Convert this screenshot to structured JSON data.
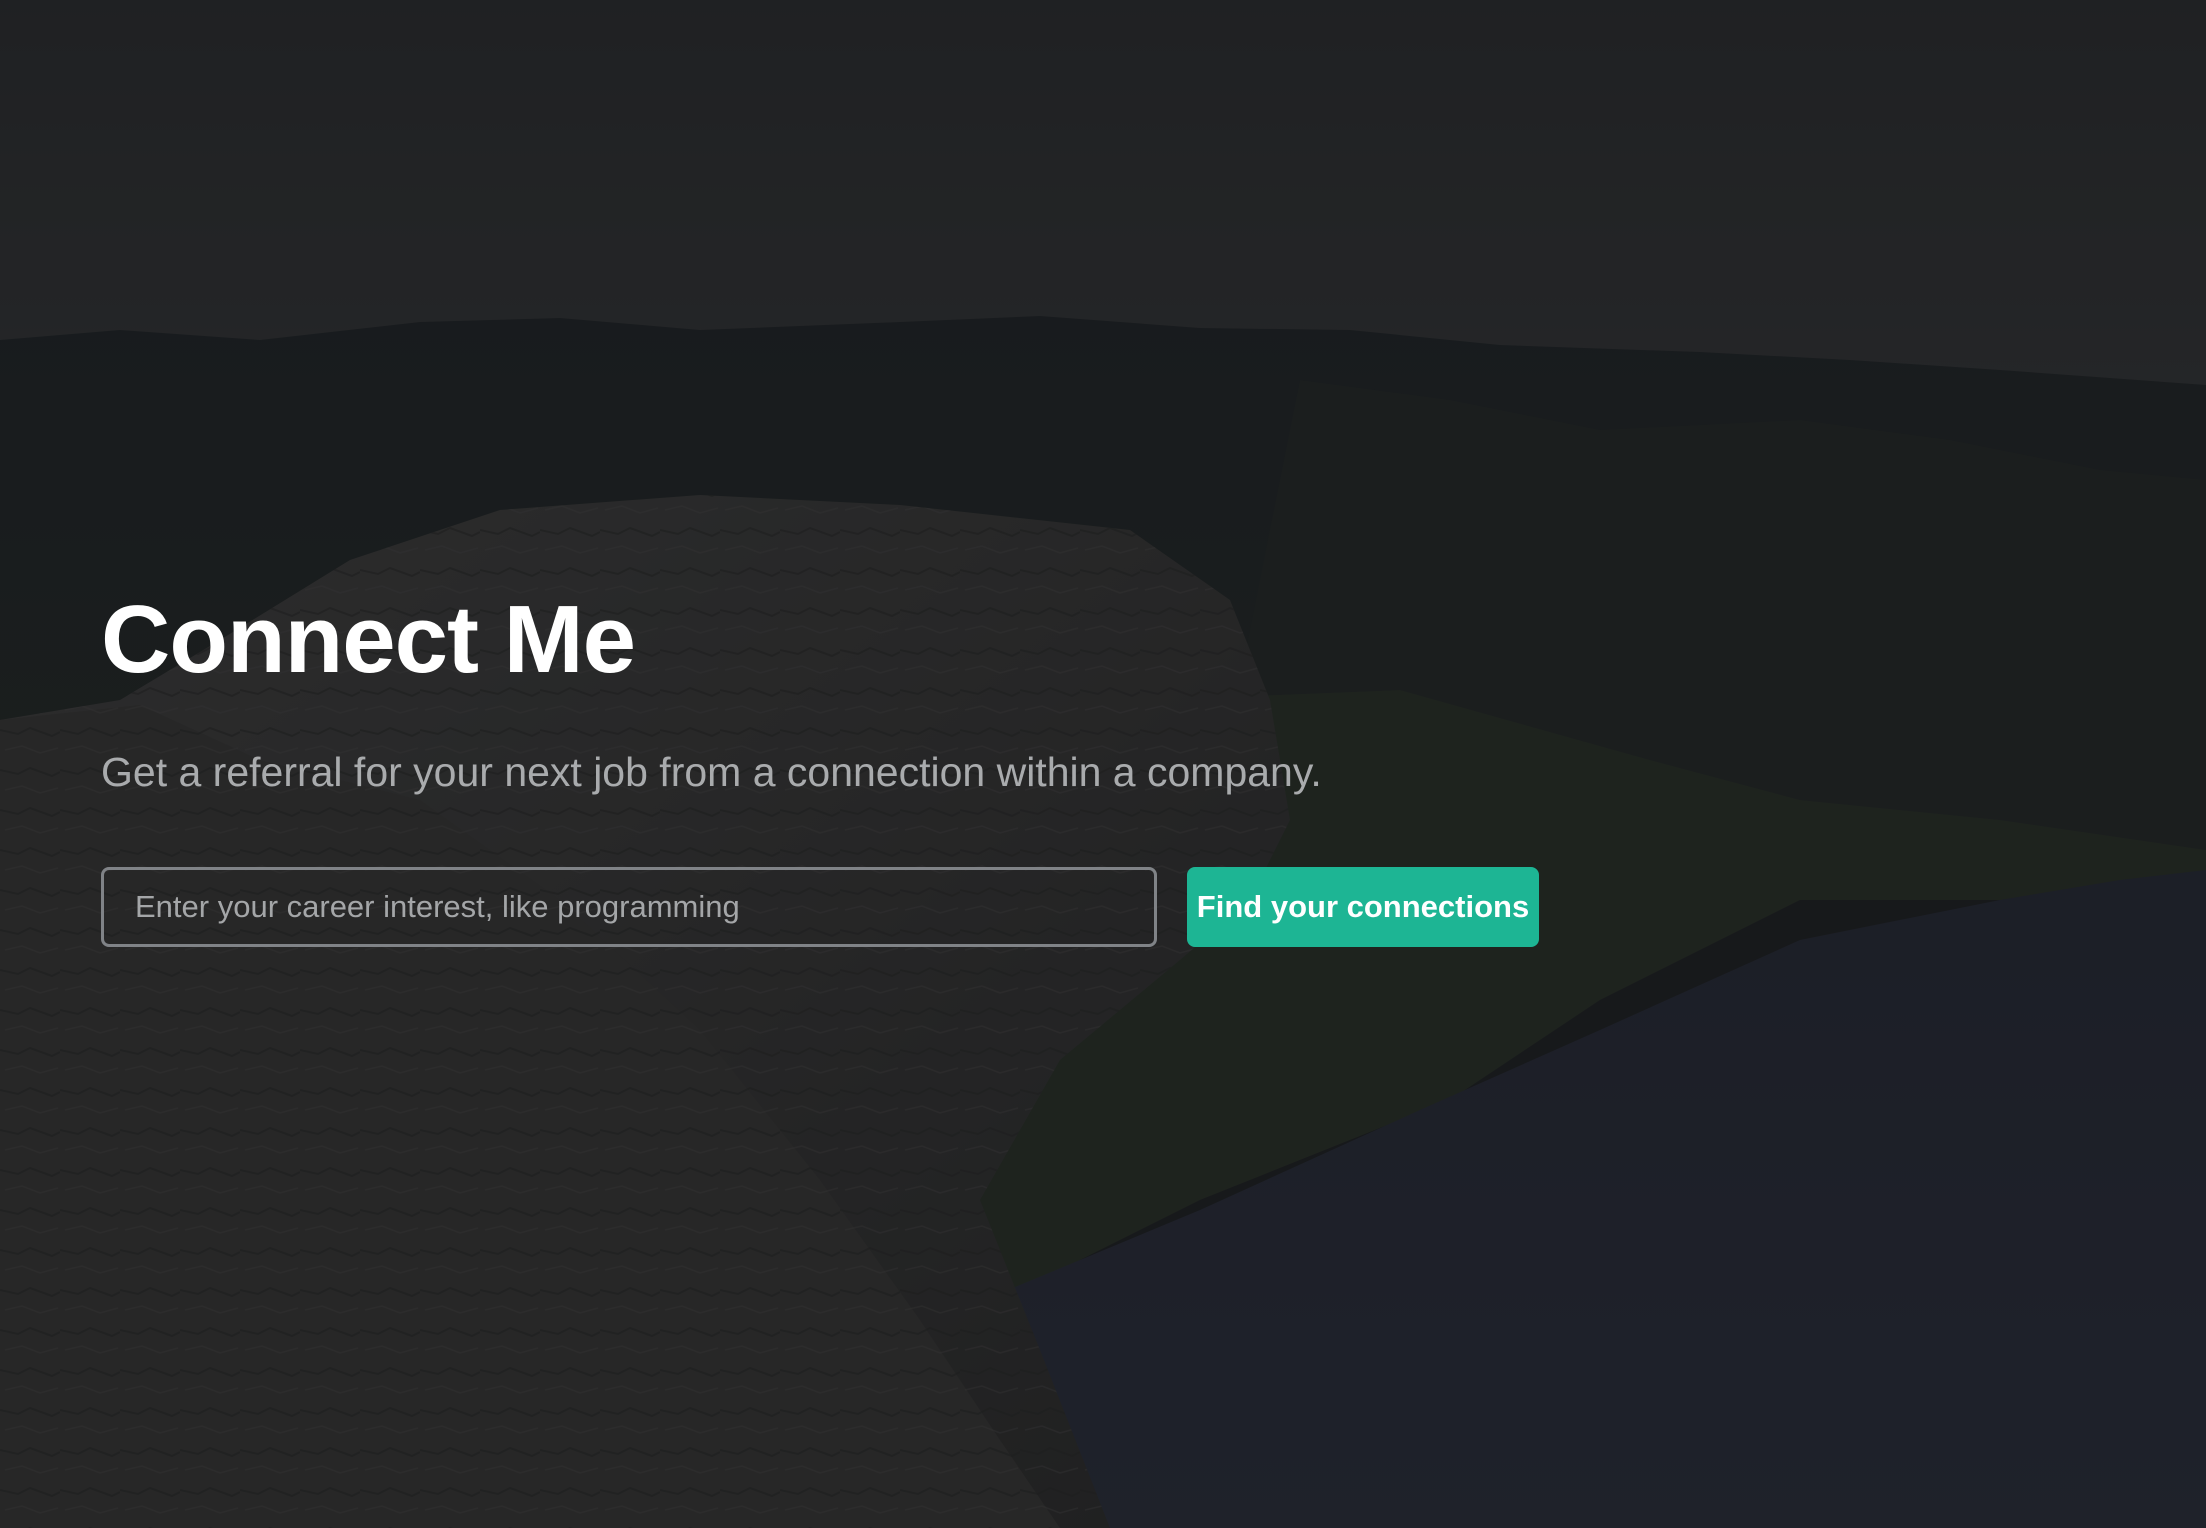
{
  "hero": {
    "title": "Connect Me",
    "subtitle": "Get a referral for your next job from a connection within a company.",
    "search": {
      "value": "",
      "placeholder": "Enter your career interest, like programming"
    },
    "button_label": "Find your connections",
    "background_image": "mountain-fjord-landscape",
    "colors": {
      "accent": "#1db594",
      "title": "#ffffff",
      "subtitle": "#a9abad",
      "input_border": "#808387",
      "overlay": "#1c1d20"
    }
  }
}
